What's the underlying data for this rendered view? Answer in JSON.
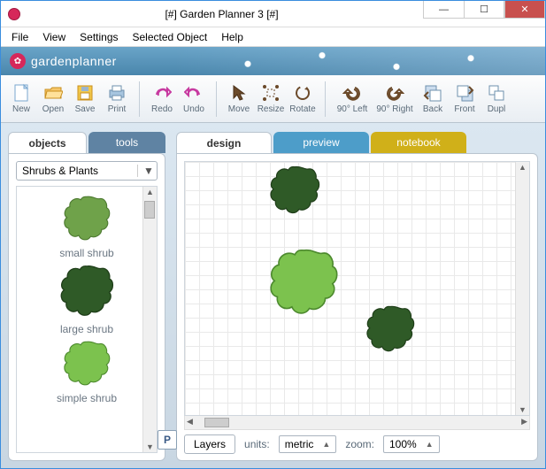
{
  "window": {
    "title": "[#] Garden Planner 3 [#]"
  },
  "menu": {
    "file": "File",
    "view": "View",
    "settings": "Settings",
    "selected": "Selected Object",
    "help": "Help"
  },
  "brand": {
    "name": "gardenplanner"
  },
  "toolbar": {
    "new": "New",
    "open": "Open",
    "save": "Save",
    "print": "Print",
    "redo": "Redo",
    "undo": "Undo",
    "move": "Move",
    "resize": "Resize",
    "rotate": "Rotate",
    "left90": "90° Left",
    "right90": "90° Right",
    "back": "Back",
    "front": "Front",
    "dupl": "Dupl"
  },
  "sidepanel": {
    "tabs": {
      "objects": "objects",
      "tools": "tools"
    },
    "category": "Shrubs & Plants",
    "items": [
      {
        "label": "small shrub"
      },
      {
        "label": "large shrub"
      },
      {
        "label": "simple shrub"
      }
    ]
  },
  "main": {
    "tabs": {
      "design": "design",
      "preview": "preview",
      "notebook": "notebook"
    },
    "status": {
      "p": "P",
      "layers": "Layers",
      "units_label": "units:",
      "units_value": "metric",
      "zoom_label": "zoom:",
      "zoom_value": "100%"
    }
  }
}
